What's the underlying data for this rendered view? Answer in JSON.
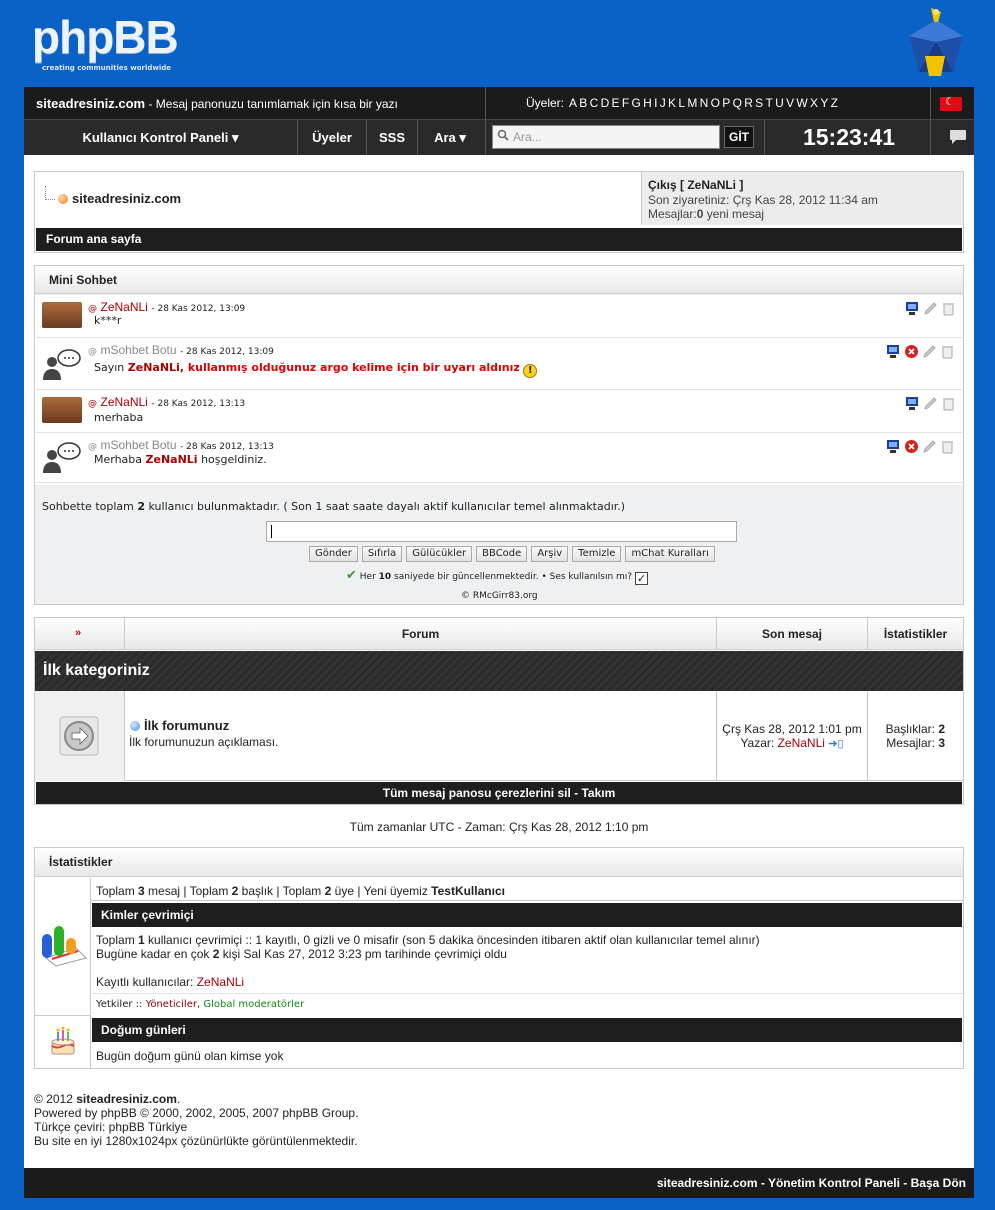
{
  "header": {
    "logo_text": "phpBB",
    "logo_tagline": "creating communities worldwide",
    "site_name": "siteadresiniz.com",
    "site_desc": "- Mesaj panonuzu tanımlamak için kısa bir yazı",
    "members_label": "Üyeler:",
    "alphabet": [
      "A",
      "B",
      "C",
      "D",
      "E",
      "F",
      "G",
      "H",
      "I",
      "J",
      "K",
      "L",
      "M",
      "N",
      "O",
      "P",
      "Q",
      "R",
      "S",
      "T",
      "U",
      "V",
      "W",
      "X",
      "Y",
      "Z"
    ]
  },
  "nav": {
    "ucp": "Kullanıcı Kontrol Paneli ▾",
    "members": "Üyeler",
    "faq": "SSS",
    "search": "Ara ▾",
    "search_placeholder": "Ara...",
    "go": "GİT",
    "clock": "15:23:41"
  },
  "crumbs": {
    "site": "siteadresiniz.com",
    "logout": "Çıkış [ ZeNaNLi ]",
    "last_visit": "Son ziyaretiniz: Çrş Kas 28, 2012 11:34 am",
    "messages_prefix": "Mesajlar:",
    "messages_count": "0",
    "messages_suffix": " yeni mesaj",
    "forum_index": "Forum ana sayfa"
  },
  "chat": {
    "title": "Mini Sohbet",
    "messages": [
      {
        "user": "ZeNaNLi",
        "time": "- 28 Kas 2012, 13:09",
        "text": "k***r"
      },
      {
        "user": "mSohbet Botu",
        "time": "- 28 Kas 2012, 13:09",
        "pre": "Sayın ",
        "mention": "ZeNaNLi",
        "post": ", kullanmış olduğunuz argo kelime için bir uyarı aldınız"
      },
      {
        "user": "ZeNaNLi",
        "time": "- 28 Kas 2012, 13:13",
        "text": "merhaba"
      },
      {
        "user": "mSohbet Botu",
        "time": "- 28 Kas 2012, 13:13",
        "pre": "Merhaba ",
        "mention": "ZeNaNLi",
        "post": " hoşgeldiniz."
      }
    ],
    "stats_pre": "Sohbette toplam ",
    "stats_count": "2",
    "stats_post": " kullanıcı bulunmaktadır.  ( Son 1 saat saate dayalı aktif kullanıcılar temel alınmaktadır.)",
    "buttons": [
      "Gönder",
      "Sıfırla",
      "Gülücükler",
      "BBCode",
      "Arşiv",
      "Temizle",
      "mChat Kuralları"
    ],
    "refresh_pre": "Her ",
    "refresh_count": "10",
    "refresh_post": " saniyede bir güncellenmektedir. • Ses kullanılsın mı?",
    "copyright": "© RMcGirr83.org"
  },
  "forum_table": {
    "col_forum": "Forum",
    "col_last": "Son mesaj",
    "col_stats": "İstatistikler",
    "category": "İlk kategoriniz",
    "forum_name": "İlk forumunuz",
    "forum_desc": "İlk forumunuzun açıklaması.",
    "last_date": "Çrş Kas 28, 2012 1:01 pm",
    "last_by": "Yazar:",
    "last_user": "ZeNaNLi",
    "topics_label": "Başlıklar:",
    "topics_count": "2",
    "posts_label": "Mesajlar:",
    "posts_count": "3",
    "footer_links": "Tüm mesaj panosu çerezlerini sil - Takım"
  },
  "timezone": "Tüm zamanlar UTC - Zaman: Çrş Kas 28, 2012 1:10 pm",
  "stats": {
    "title": "İstatistikler",
    "totals": [
      "Toplam ",
      "3",
      " mesaj | Toplam ",
      "2",
      " başlık | Toplam ",
      "2",
      " üye | Yeni üyemiz ",
      "TestKullanıcı"
    ],
    "online_title": "Kimler çevrimiçi",
    "online_pre": "Toplam ",
    "online_count": "1",
    "online_post": " kullanıcı çevrimiçi :: 1 kayıtlı, 0 gizli ve 0 misafir (son 5 dakika öncesinden itibaren aktif olan kullanıcılar temel alınır)",
    "record_pre": "Bugüne kadar en çok ",
    "record_count": "2",
    "record_post": " kişi Sal Kas 27, 2012 3:23 pm tarihinde çevrimiçi oldu",
    "registered_label": "Kayıtlı kullanıcılar: ",
    "registered_user": "ZeNaNLi",
    "legend_label": "Yetkiler :: ",
    "legend_admins": "Yöneticiler",
    "legend_sep": ", ",
    "legend_mods": "Global moderatörler",
    "birthday_title": "Doğum günleri",
    "birthday_text": "Bugün doğum günü olan kimse yok"
  },
  "footer": {
    "copy_pre": "© 2012 ",
    "copy_site": "siteadresiniz.com",
    "copy_post": ".",
    "powered": "Powered by phpBB © 2000, 2002, 2005, 2007 phpBB Group.",
    "translation": "Türkçe çeviri: phpBB Türkiye",
    "resolution": "Bu site en iyi 1280x1024px çözünürlükte görüntülenmektedir.",
    "bottom_links": "siteadresiniz.com - Yönetim Kontrol Paneli - Başa Dön"
  }
}
